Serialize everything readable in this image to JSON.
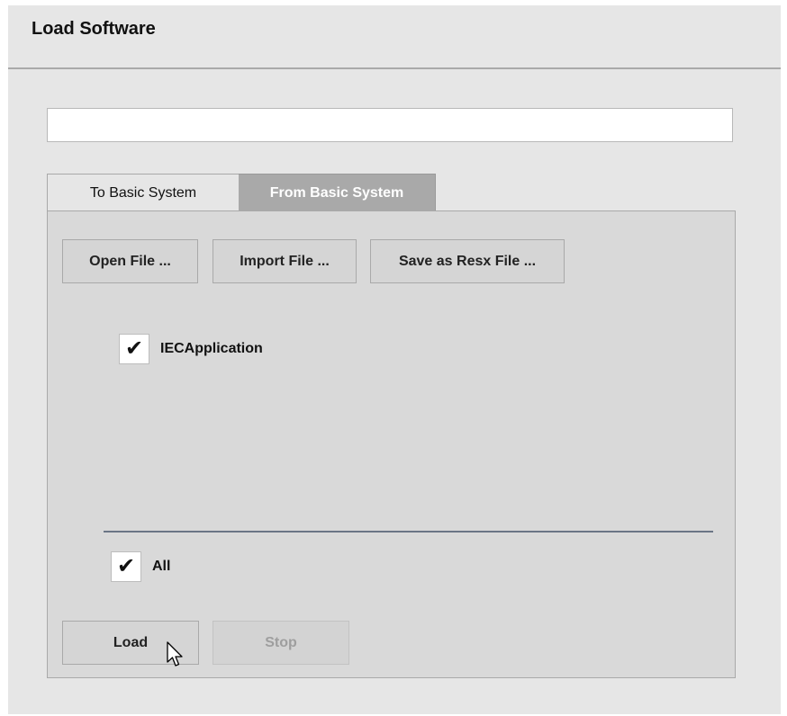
{
  "window": {
    "title": "Load Software"
  },
  "path_field": {
    "value": "",
    "placeholder": ""
  },
  "tabs": [
    {
      "label": "To Basic System",
      "selected": false
    },
    {
      "label": "From Basic System",
      "selected": true
    }
  ],
  "toolbar": {
    "open_label": "Open File ...",
    "import_label": "Import File ...",
    "save_label": "Save as Resx File ..."
  },
  "items": [
    {
      "label": "IECApplication",
      "checked": true
    }
  ],
  "select_all": {
    "label": "All",
    "checked": true
  },
  "actions": {
    "load_label": "Load",
    "stop_label": "Stop",
    "stop_enabled": false
  },
  "icons": {
    "checkmark": "check-icon",
    "cursor": "mouse-pointer-icon"
  }
}
